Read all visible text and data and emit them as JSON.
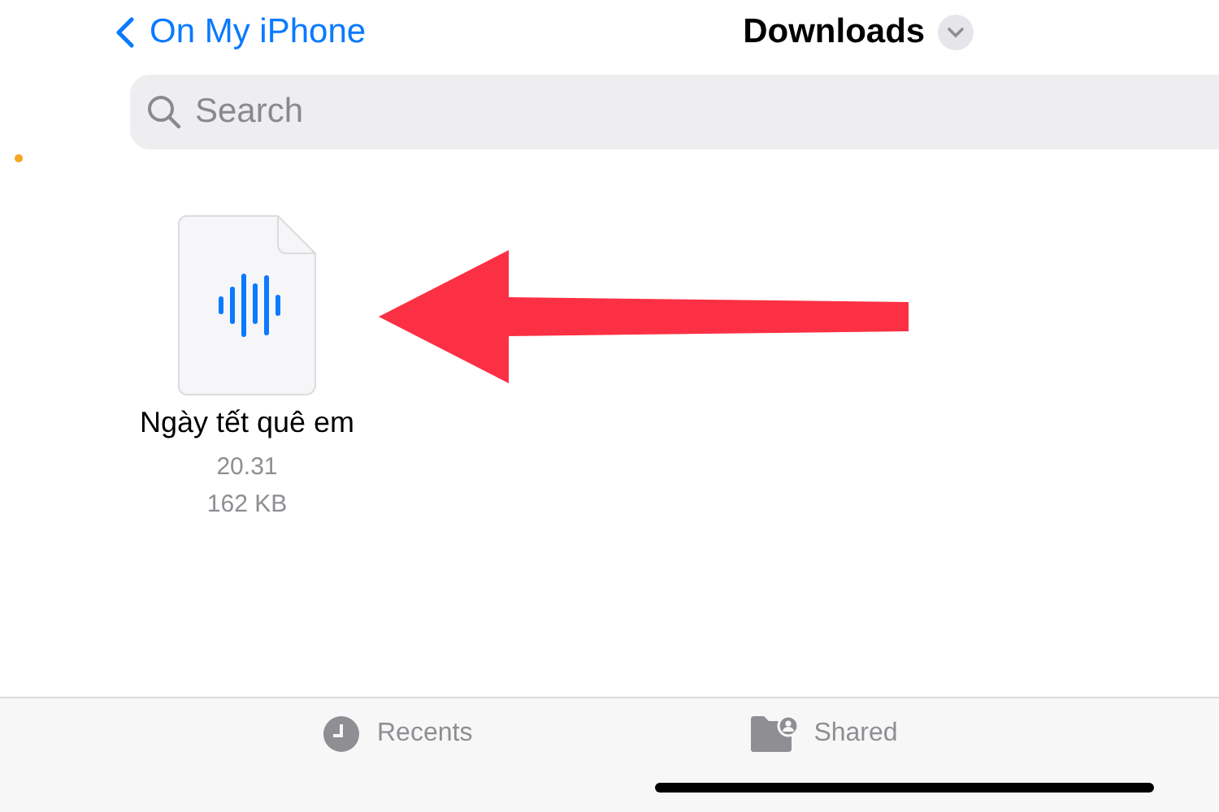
{
  "nav": {
    "back_label": "On My iPhone",
    "title": "Downloads"
  },
  "search": {
    "placeholder": "Search"
  },
  "files": [
    {
      "kind": "audio",
      "name": "Ngày tết quê em",
      "time": "20.31",
      "size": "162 KB"
    }
  ],
  "tabs": [
    {
      "kind": "clock",
      "label": "Recents",
      "selected": false
    },
    {
      "kind": "shared-folder",
      "label": "Shared",
      "selected": false
    }
  ]
}
